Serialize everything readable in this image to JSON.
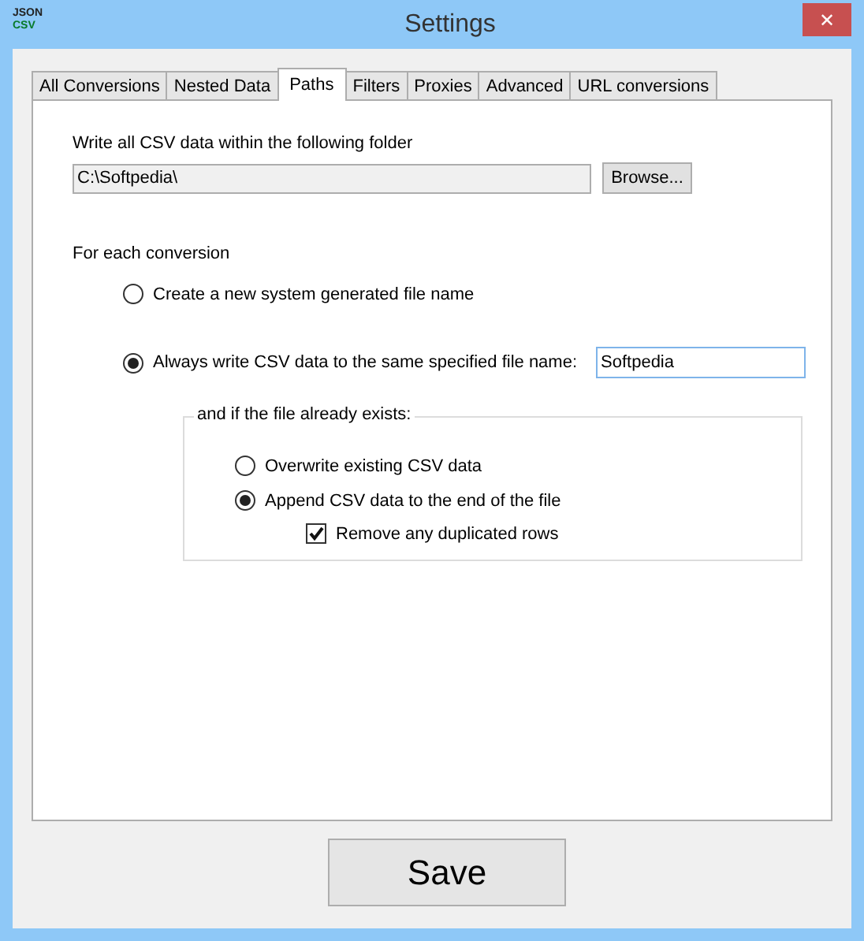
{
  "window": {
    "title": "Settings",
    "logo": [
      "JSON",
      "CSV"
    ],
    "close": "✕"
  },
  "tabs": [
    {
      "label": "All Conversions",
      "selected": false
    },
    {
      "label": "Nested Data",
      "selected": false
    },
    {
      "label": "Paths",
      "selected": true
    },
    {
      "label": "Filters",
      "selected": false
    },
    {
      "label": "Proxies",
      "selected": false
    },
    {
      "label": "Advanced",
      "selected": false
    },
    {
      "label": "URL conversions",
      "selected": false
    }
  ],
  "folder": {
    "label": "Write all CSV data within the following folder",
    "value": "C:\\Softpedia\\",
    "browse": "Browse..."
  },
  "conversion": {
    "label": "For each conversion",
    "options": [
      {
        "label": "Create a new system generated file name",
        "selected": false
      },
      {
        "label": "Always write CSV data to the same specified file name:",
        "selected": true,
        "file_name": "Softpedia"
      }
    ]
  },
  "exists_group": {
    "legend": "and if the file already exists:",
    "options": [
      {
        "label": "Overwrite existing CSV data",
        "selected": false
      },
      {
        "label": "Append CSV data to the end of the file",
        "selected": true
      }
    ],
    "remove_duplicates": {
      "label": "Remove any duplicated rows",
      "checked": true
    }
  },
  "save": "Save"
}
